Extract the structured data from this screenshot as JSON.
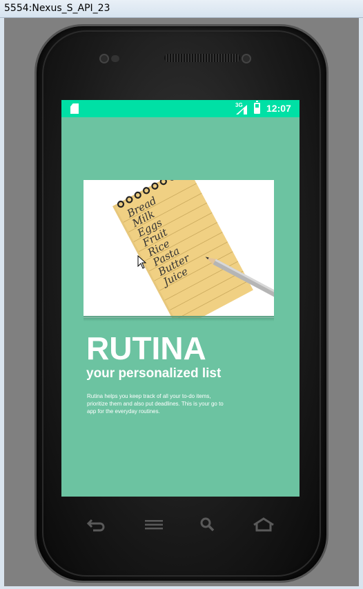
{
  "window": {
    "title": "5554:Nexus_S_API_23"
  },
  "statusbar": {
    "network": "3G",
    "time": "12:07"
  },
  "app": {
    "title": "RUTINA",
    "subtitle": "your personalized list",
    "description": "Rutina helps you keep track of all your to-do items, prioritize them and also put deadlines. This is your go to app for the everyday routines."
  },
  "notepad_words": [
    "Bread",
    "Milk",
    "Eggs",
    "Fruit",
    "Rice",
    "Pasta",
    "Butter",
    "Juice"
  ],
  "colors": {
    "statusbar": "#00e0a5",
    "background": "#6cc3a1",
    "notepad": "#f0d083"
  },
  "icons": {
    "back": "back-icon",
    "menu": "menu-icon",
    "search": "search-icon",
    "home": "home-icon"
  }
}
